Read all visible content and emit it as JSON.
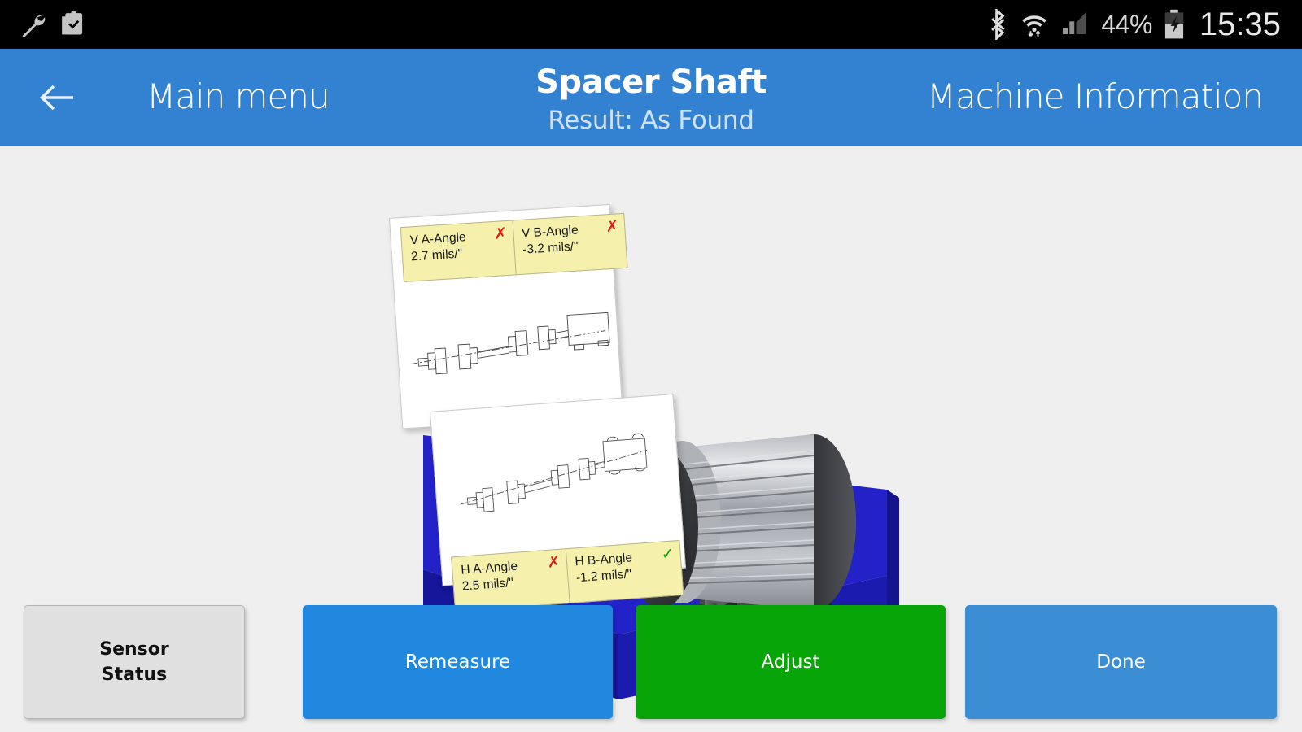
{
  "statusbar": {
    "left_icons": [
      "wrench-icon",
      "clipboard-check-icon"
    ],
    "right_icons": [
      "bluetooth-icon",
      "wifi-icon",
      "cellular-signal-icon",
      "battery-charging-icon"
    ],
    "battery_percent": "44%",
    "clock": "15:35"
  },
  "header": {
    "back_icon": "back-arrow-icon",
    "back_label": "Main menu",
    "title": "Spacer Shaft",
    "subtitle": "Result: As Found",
    "right_label": "Machine Information",
    "bar_color": "#3382d1"
  },
  "readings": {
    "vertical": [
      {
        "label": "V A-Angle",
        "value": "2.7 mils/\"",
        "status": "fail",
        "mark": "✗"
      },
      {
        "label": "V B-Angle",
        "value": "-3.2 mils/\"",
        "status": "fail",
        "mark": "✗"
      }
    ],
    "horizontal": [
      {
        "label": "H A-Angle",
        "value": "2.5 mils/\"",
        "status": "fail",
        "mark": "✗"
      },
      {
        "label": "H B-Angle",
        "value": "-1.2 mils/\"",
        "status": "pass",
        "mark": "✓"
      }
    ]
  },
  "graphic": {
    "machine": "electric-motor-3d",
    "base_color": "#2222c8",
    "base_side_color": "#1a1a9e",
    "diagram": "spacer-shaft-coupling-schematic"
  },
  "buttons": {
    "sensor_status_line1": "Sensor",
    "sensor_status_line2": "Status",
    "remeasure": "Remeasure",
    "adjust": "Adjust",
    "done": "Done",
    "remeasure_color": "#2188e0",
    "adjust_color": "#08a508",
    "done_color": "#3b8ed3"
  }
}
